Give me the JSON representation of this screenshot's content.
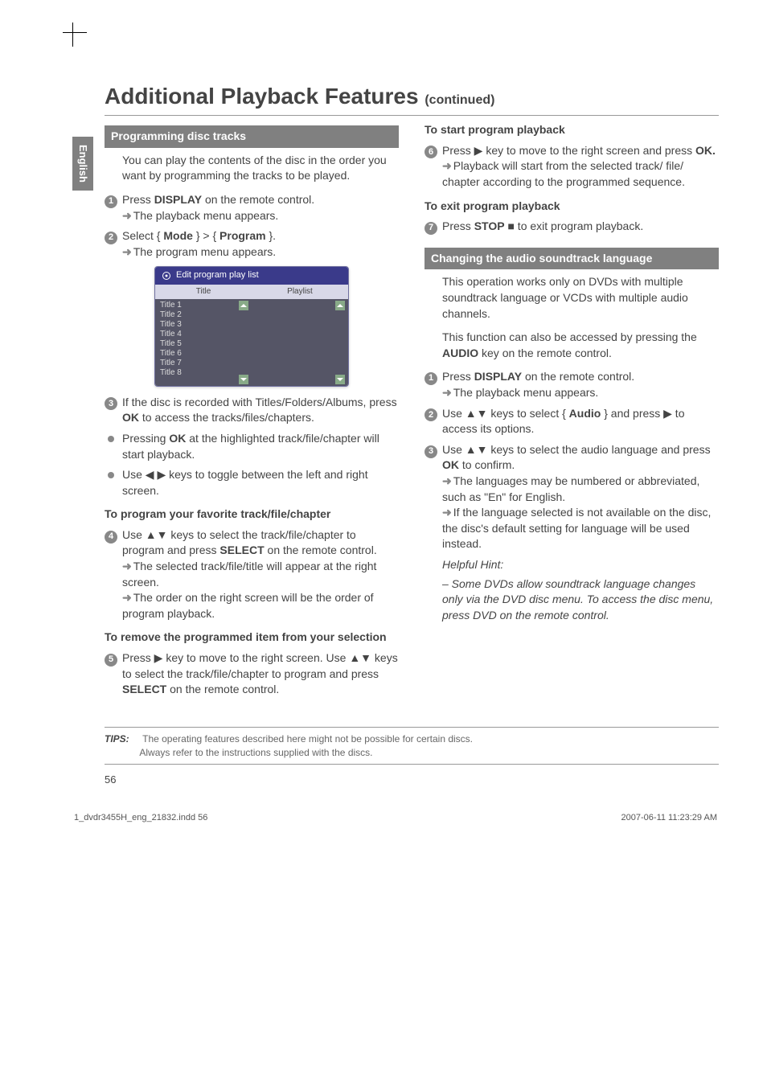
{
  "lang_tab": "English",
  "title_main": "Additional Playback Features ",
  "title_cont": "(continued)",
  "left": {
    "section1": "Programming disc tracks",
    "intro": "You can play the contents of the disc in the order you want by programming the tracks to be played.",
    "step1_a": "Press ",
    "step1_b": "DISPLAY",
    "step1_c": " on the remote control.",
    "step1_res": "The playback menu appears.",
    "step2_a": "Select { ",
    "step2_b": "Mode",
    "step2_c": " } > { ",
    "step2_d": "Program",
    "step2_e": " }.",
    "step2_res": "The program menu appears.",
    "playlist_title": "Edit program play list",
    "playlist_col1": "Title",
    "playlist_col2": "Playlist",
    "playlist_items": [
      "Title 1",
      "Title 2",
      "Title 3",
      "Title 4",
      "Title 5",
      "Title 6",
      "Title 7",
      "Title 8"
    ],
    "step3_a": "If the disc is recorded with Titles/Folders/Albums, press ",
    "step3_b": "OK",
    "step3_c": " to access the tracks/files/chapters.",
    "bullet1_a": "Pressing ",
    "bullet1_b": "OK",
    "bullet1_c": " at the highlighted track/file/chapter will start playback.",
    "bullet2": "Use ◀ ▶ keys to toggle between the left and right screen.",
    "sub1": "To program your favorite track/file/chapter",
    "step4_a": "Use ▲▼ keys to select the track/file/chapter to program and press ",
    "step4_b": "SELECT",
    "step4_c": " on the remote control.",
    "step4_res1": "The selected track/file/title will appear at the right screen.",
    "step4_res2": "The order on the right screen will be the order of program playback.",
    "sub2": "To remove the programmed item from your selection",
    "step5_a": "Press ▶ key to move to the right screen. Use ▲▼ keys to select the track/file/chapter to program and press ",
    "step5_b": "SELECT",
    "step5_c": " on the remote control."
  },
  "right": {
    "sub1": "To start program playback",
    "step6_a": "Press ▶ key to move to the right screen and press ",
    "step6_b": "OK.",
    "step6_res": "Playback will start from the selected track/ file/ chapter according to the programmed sequence.",
    "sub2": "To exit program playback",
    "step7_a": "Press ",
    "step7_b": "STOP",
    "step7_c": " ■ to exit program playback.",
    "section2": "Changing the audio soundtrack language",
    "para1": "This operation works only on DVDs with multiple soundtrack language or VCDs with multiple audio channels.",
    "para2_a": "This function can also be accessed by pressing the ",
    "para2_b": "AUDIO",
    "para2_c": " key on the remote control.",
    "r_step1_a": "Press ",
    "r_step1_b": "DISPLAY",
    "r_step1_c": " on the remote control.",
    "r_step1_res": "The playback menu appears.",
    "r_step2_a": "Use ▲▼ keys to select { ",
    "r_step2_b": "Audio",
    "r_step2_c": " } and press ▶ to access its options.",
    "r_step3_a": "Use ▲▼ keys to select the audio language and press ",
    "r_step3_b": "OK",
    "r_step3_c": " to confirm.",
    "r_step3_res1": "The languages may be numbered or abbreviated, such as \"En\" for English.",
    "r_step3_res2": "If the language selected is not available on the disc, the disc's default setting for language will be used instead.",
    "hint_head": "Helpful Hint:",
    "hint_body": "– Some DVDs allow soundtrack language changes only via the DVD disc menu. To access the disc menu, press DVD on the remote control."
  },
  "tips_label": "TIPS:",
  "tips_line1": "The operating features described here might not be possible for certain discs.",
  "tips_line2": "Always refer to the instructions supplied with the discs.",
  "page_num": "56",
  "footer_left": "1_dvdr3455H_eng_21832.indd   56",
  "footer_right": "2007-06-11   11:23:29 AM"
}
